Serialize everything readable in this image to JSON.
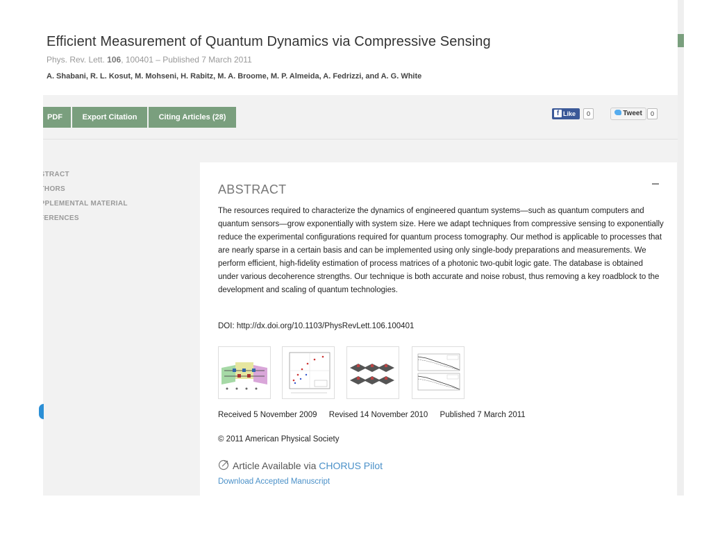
{
  "article": {
    "title": "Efficient Measurement of Quantum Dynamics via Compressive Sensing",
    "journal": "Phys. Rev. Lett.",
    "volume": "106",
    "citation_rest": ", 100401 – Published 7 March 2011",
    "authors": "A. Shabani, R. L. Kosut, M. Mohseni, H. Rabitz, M. A. Broome, M. P. Almeida, A. Fedrizzi, and A. G. White"
  },
  "toolbar": {
    "pdf_label": "PDF",
    "export_label": "Export Citation",
    "citing_label": "Citing Articles (28)",
    "button_color": "#7a9f7e"
  },
  "social": {
    "like_label": "Like",
    "like_count": "0",
    "tweet_label": "Tweet",
    "tweet_count": "0"
  },
  "side_nav": {
    "items": [
      "BSTRACT",
      "UTHORS",
      "UPPLEMENTAL MATERIAL",
      "EFERENCES"
    ]
  },
  "abstract": {
    "heading": "ABSTRACT",
    "text": "The resources required to characterize the dynamics of engineered quantum systems—such as quantum computers and quantum sensors—grow exponentially with system size. Here we adapt techniques from compressive sensing to exponentially reduce the experimental configurations required for quantum process tomography. Our method is applicable to processes that are nearly sparse in a certain basis and can be implemented using only single-body preparations and measurements. We perform efficient, high-fidelity estimation of process matrices of a photonic two-qubit logic gate. The database is obtained under various decoherence strengths. Our technique is both accurate and noise robust, thus removing a key roadblock to the development and scaling of quantum technologies.",
    "doi": "DOI: http://dx.doi.org/10.1103/PhysRevLett.106.100401"
  },
  "figures": [
    {
      "name": "figure-1-thumbnail",
      "icon": "optical-setup-diagram"
    },
    {
      "name": "figure-2-thumbnail",
      "icon": "scatter-plot"
    },
    {
      "name": "figure-3-thumbnail",
      "icon": "3d-bar-matrices"
    },
    {
      "name": "figure-4-thumbnail",
      "icon": "line-plots"
    }
  ],
  "dates": {
    "received": "Received 5 November 2009",
    "revised": "Revised 14 November 2010",
    "published": "Published 7 March 2011"
  },
  "copyright": "© 2011 American Physical Society",
  "chorus": {
    "prefix": "Article Available via ",
    "link": "CHORUS Pilot",
    "icon": "external-link-icon"
  },
  "download_label": "Download Accepted Manuscript",
  "colors": {
    "accent": "#7a9f7e",
    "link": "#4a90c8",
    "facebook": "#3b5998"
  }
}
